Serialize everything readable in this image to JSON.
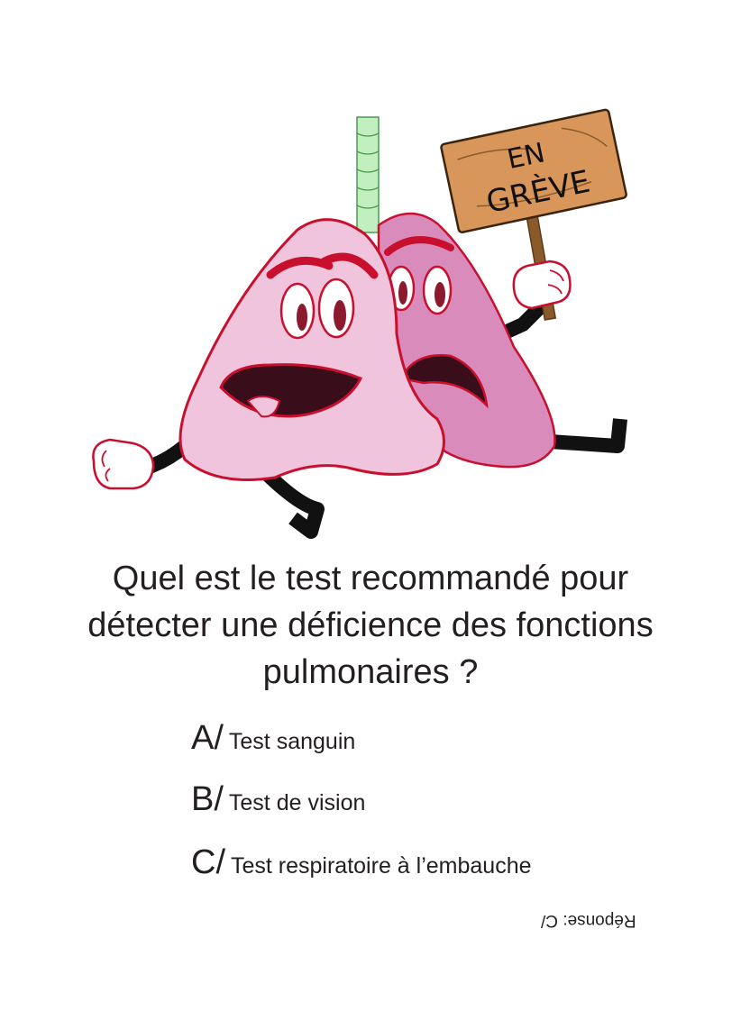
{
  "illustration": {
    "sign_line1": "EN",
    "sign_line2": "GRÈVE",
    "colors": {
      "front_lung": "#f0c4dc",
      "back_lung": "#d98cbc",
      "outline": "#c8102e",
      "trachea": "#c2efc0",
      "sign_board": "#d9965a",
      "stick": "#8b5a2b",
      "mouth": "#3a0d1a",
      "pupil": "#8b1a2e"
    },
    "icons": [
      "lungs-character-icon",
      "strike-sign-icon",
      "glove-hand-icon"
    ]
  },
  "quiz": {
    "question": "Quel est le test recommandé pour détecter une déficience des fonctions pulmonaires ?",
    "options": [
      {
        "letter": "A/",
        "text": "Test sanguin"
      },
      {
        "letter": "B/",
        "text": "Test de vision"
      },
      {
        "letter": "C/",
        "text": "Test respiratoire à l’embauche"
      }
    ],
    "answer": "Réponse: C/"
  }
}
